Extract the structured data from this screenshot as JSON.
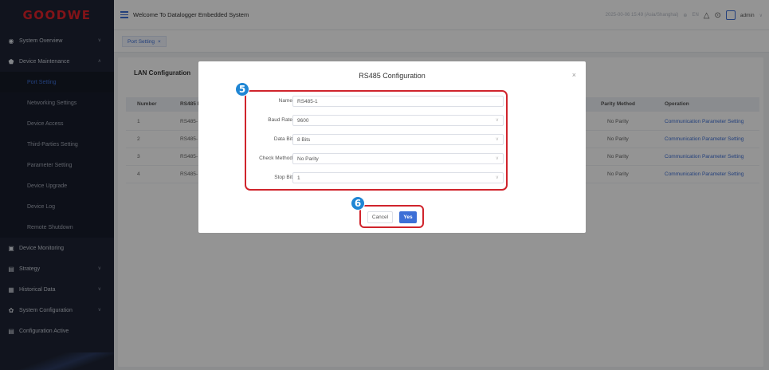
{
  "app": {
    "logo": "GOODWE",
    "title": "Welcome To Datalogger Embedded System"
  },
  "topbar": {
    "datetime": "2025-00-06 15:49 (Asia/Shanghai)",
    "lang": "EN",
    "user": "admin"
  },
  "sidebar": {
    "groups": [
      {
        "label": "System Overview",
        "icon": "gauge-icon",
        "chev": "∨"
      },
      {
        "label": "Device Maintenance",
        "icon": "shield-icon",
        "chev": "∧"
      }
    ],
    "sub_items": [
      {
        "label": "Port Setting",
        "active": true
      },
      {
        "label": "Networking Settings"
      },
      {
        "label": "Device Access"
      },
      {
        "label": "Third-Parties Setting"
      },
      {
        "label": "Parameter Setting"
      },
      {
        "label": "Device Upgrade"
      },
      {
        "label": "Device Log"
      },
      {
        "label": "Remote Shutdown"
      }
    ],
    "groups_after": [
      {
        "label": "Device Monitoring",
        "icon": "monitor-icon"
      },
      {
        "label": "Strategy",
        "icon": "strategy-icon",
        "chev": "∨"
      },
      {
        "label": "Historical Data",
        "icon": "chart-icon",
        "chev": "∨"
      },
      {
        "label": "System Configuration",
        "icon": "gear-icon",
        "chev": "∨"
      },
      {
        "label": "Configuration Active",
        "icon": "config-icon"
      }
    ]
  },
  "tabs": [
    {
      "label": "Port Setting",
      "close": "×"
    }
  ],
  "card": {
    "title": "LAN Configuration",
    "columns": {
      "number": "Number",
      "rs485": "RS485 I",
      "parity": "Parity Method",
      "operation": "Operation"
    },
    "rows": [
      {
        "number": "1",
        "rs485": "RS485-",
        "parity": "No Parity",
        "operation": "Communication Parameter Setting"
      },
      {
        "number": "2",
        "rs485": "RS485-",
        "parity": "No Parity",
        "operation": "Communication Parameter Setting"
      },
      {
        "number": "3",
        "rs485": "RS485-",
        "parity": "No Parity",
        "operation": "Communication Parameter Setting"
      },
      {
        "number": "4",
        "rs485": "RS485-",
        "parity": "No Parity",
        "operation": "Communication Parameter Setting"
      }
    ]
  },
  "modal": {
    "title": "RS485 Configuration",
    "close": "×",
    "fields": [
      {
        "label": "Name",
        "value": "RS485-1",
        "select": false
      },
      {
        "label": "Baud Rate",
        "value": "9600",
        "select": true
      },
      {
        "label": "Data Bit",
        "value": "8 Bits",
        "select": true
      },
      {
        "label": "Check Method",
        "value": "No Parity",
        "select": true
      },
      {
        "label": "Stop Bit",
        "value": "1",
        "select": true
      }
    ],
    "cancel_label": "Cancel",
    "yes_label": "Yes"
  },
  "steps": {
    "form": "5",
    "buttons": "6"
  },
  "colors": {
    "accent": "#3d6fd6",
    "highlight": "#d0242c",
    "step_badge": "#1f86d4",
    "sidebar_bg": "#1e2434",
    "logo": "#e0222a"
  }
}
